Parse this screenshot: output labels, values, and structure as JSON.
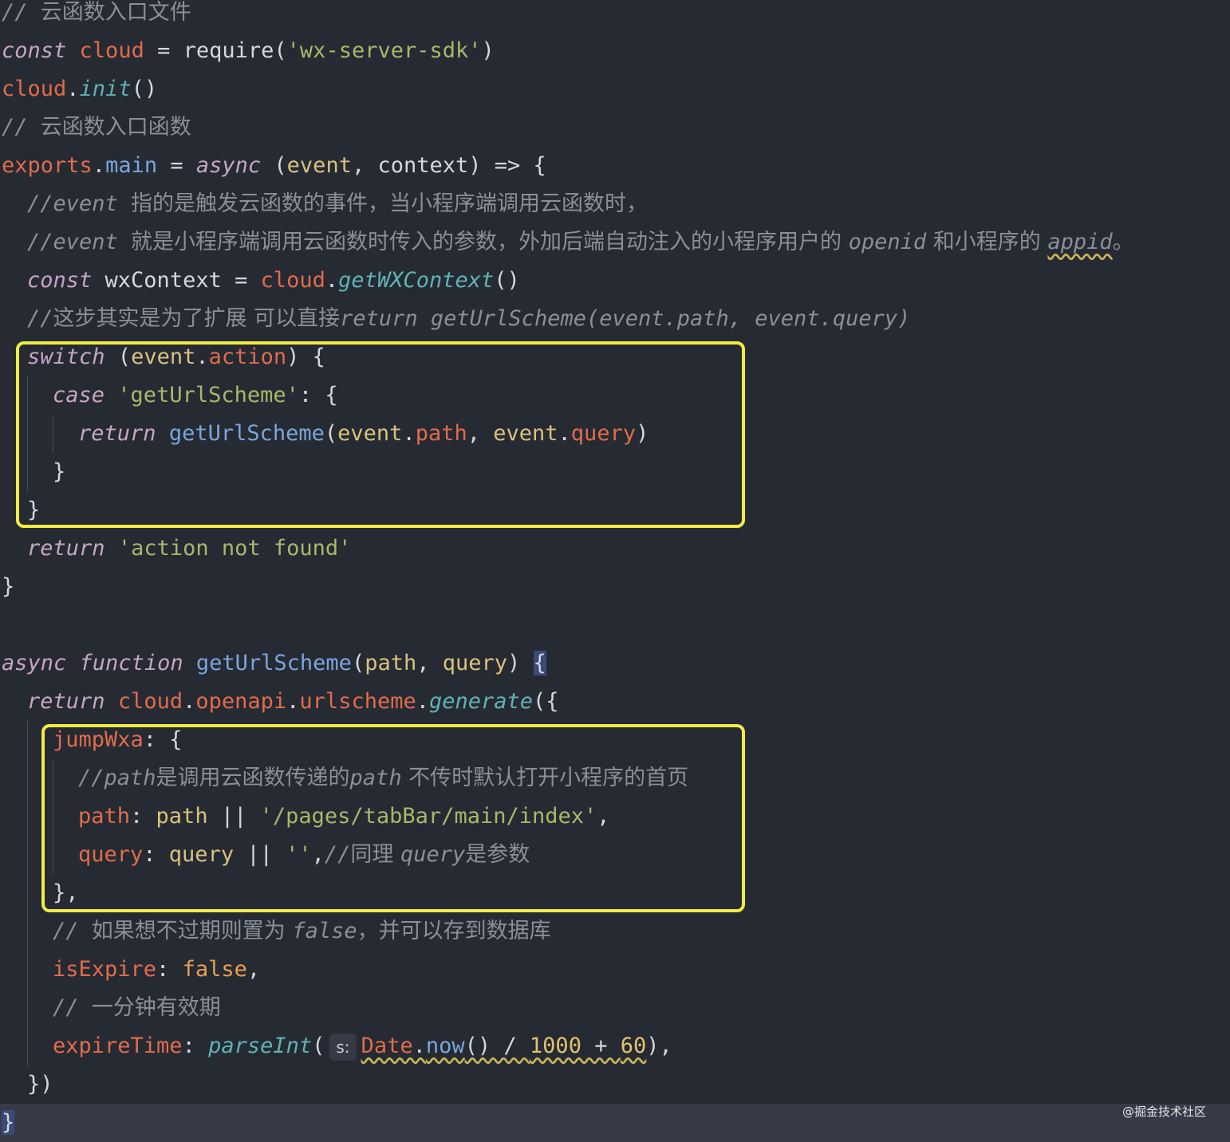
{
  "code_lines": [
    {
      "indent": 0,
      "tokens": [
        {
          "t": "// ",
          "c": "cmt"
        },
        {
          "t": "云函数入口文件",
          "c": "cmtcn"
        }
      ]
    },
    {
      "indent": 0,
      "tokens": [
        {
          "t": "const",
          "c": "kw"
        },
        {
          "t": " ",
          "c": "plain"
        },
        {
          "t": "cloud",
          "c": "ident"
        },
        {
          "t": " = ",
          "c": "plain"
        },
        {
          "t": "require",
          "c": "plain"
        },
        {
          "t": "(",
          "c": "plain"
        },
        {
          "t": "'wx-server-sdk'",
          "c": "str"
        },
        {
          "t": ")",
          "c": "plain"
        }
      ]
    },
    {
      "indent": 0,
      "tokens": [
        {
          "t": "cloud",
          "c": "ident"
        },
        {
          "t": ".",
          "c": "plain"
        },
        {
          "t": "init",
          "c": "fn"
        },
        {
          "t": "()",
          "c": "plain"
        }
      ]
    },
    {
      "indent": 0,
      "tokens": [
        {
          "t": "// ",
          "c": "cmt"
        },
        {
          "t": "云函数入口函数",
          "c": "cmtcn"
        }
      ]
    },
    {
      "indent": 0,
      "tokens": [
        {
          "t": "exports",
          "c": "ident"
        },
        {
          "t": ".",
          "c": "plain"
        },
        {
          "t": "main",
          "c": "fnname"
        },
        {
          "t": " = ",
          "c": "plain"
        },
        {
          "t": "async",
          "c": "kw"
        },
        {
          "t": " (",
          "c": "plain"
        },
        {
          "t": "event",
          "c": "param"
        },
        {
          "t": ", ",
          "c": "plain"
        },
        {
          "t": "context",
          "c": "plain"
        },
        {
          "t": ") => {",
          "c": "plain"
        }
      ]
    },
    {
      "indent": 1,
      "tokens": [
        {
          "t": "//event ",
          "c": "cmt"
        },
        {
          "t": "指的是触发云函数的事件，当小程序端调用云函数时，",
          "c": "cmtcn"
        }
      ]
    },
    {
      "indent": 1,
      "tokens": [
        {
          "t": "//event ",
          "c": "cmt"
        },
        {
          "t": "就是小程序端调用云函数时传入的参数，外加后端自动注入的小程序用户的 ",
          "c": "cmtcn"
        },
        {
          "t": "openid",
          "c": "cmt"
        },
        {
          "t": " 和小程序的 ",
          "c": "cmtcn"
        },
        {
          "t": "appid",
          "c": "cmt",
          "squiggle": true
        },
        {
          "t": "。",
          "c": "cmtcn"
        }
      ]
    },
    {
      "indent": 1,
      "tokens": [
        {
          "t": "const",
          "c": "kw"
        },
        {
          "t": " wxContext = ",
          "c": "plain"
        },
        {
          "t": "cloud",
          "c": "ident"
        },
        {
          "t": ".",
          "c": "plain"
        },
        {
          "t": "getWXContext",
          "c": "fn"
        },
        {
          "t": "()",
          "c": "plain"
        }
      ]
    },
    {
      "indent": 1,
      "tokens": [
        {
          "t": "//",
          "c": "cmt"
        },
        {
          "t": "这步其实是为了扩展 可以直接",
          "c": "cmtcn"
        },
        {
          "t": "return getUrlScheme(event.path, event.query)",
          "c": "cmt"
        }
      ]
    },
    {
      "indent": 1,
      "tokens": [
        {
          "t": "switch",
          "c": "kw"
        },
        {
          "t": " (",
          "c": "plain"
        },
        {
          "t": "event",
          "c": "param"
        },
        {
          "t": ".",
          "c": "plain"
        },
        {
          "t": "action",
          "c": "prop"
        },
        {
          "t": ") {",
          "c": "plain"
        }
      ]
    },
    {
      "indent": 2,
      "tokens": [
        {
          "t": "case",
          "c": "kw"
        },
        {
          "t": " ",
          "c": "plain"
        },
        {
          "t": "'getUrlScheme'",
          "c": "str"
        },
        {
          "t": ": {",
          "c": "plain"
        }
      ]
    },
    {
      "indent": 3,
      "tokens": [
        {
          "t": "return",
          "c": "kw"
        },
        {
          "t": " ",
          "c": "plain"
        },
        {
          "t": "getUrlScheme",
          "c": "fnname"
        },
        {
          "t": "(",
          "c": "plain"
        },
        {
          "t": "event",
          "c": "param"
        },
        {
          "t": ".",
          "c": "plain"
        },
        {
          "t": "path",
          "c": "prop"
        },
        {
          "t": ", ",
          "c": "plain"
        },
        {
          "t": "event",
          "c": "param"
        },
        {
          "t": ".",
          "c": "plain"
        },
        {
          "t": "query",
          "c": "prop"
        },
        {
          "t": ")",
          "c": "plain"
        }
      ]
    },
    {
      "indent": 2,
      "tokens": [
        {
          "t": "}",
          "c": "plain"
        }
      ]
    },
    {
      "indent": 1,
      "tokens": [
        {
          "t": "}",
          "c": "plain"
        }
      ]
    },
    {
      "indent": 1,
      "tokens": [
        {
          "t": "return",
          "c": "kw"
        },
        {
          "t": " ",
          "c": "plain"
        },
        {
          "t": "'action not found'",
          "c": "str"
        }
      ]
    },
    {
      "indent": 0,
      "tokens": [
        {
          "t": "}",
          "c": "plain"
        }
      ]
    },
    {
      "indent": 0,
      "tokens": []
    },
    {
      "indent": 0,
      "tokens": [
        {
          "t": "async",
          "c": "kw"
        },
        {
          "t": " ",
          "c": "plain"
        },
        {
          "t": "function",
          "c": "kw"
        },
        {
          "t": " ",
          "c": "plain"
        },
        {
          "t": "getUrlScheme",
          "c": "fnname"
        },
        {
          "t": "(",
          "c": "plain"
        },
        {
          "t": "path",
          "c": "param"
        },
        {
          "t": ", ",
          "c": "plain"
        },
        {
          "t": "query",
          "c": "param"
        },
        {
          "t": ") ",
          "c": "plain"
        },
        {
          "t": "{",
          "c": "plain",
          "bracket": true
        }
      ]
    },
    {
      "indent": 1,
      "tokens": [
        {
          "t": "return",
          "c": "kw"
        },
        {
          "t": " ",
          "c": "plain"
        },
        {
          "t": "cloud",
          "c": "ident"
        },
        {
          "t": ".",
          "c": "plain"
        },
        {
          "t": "openapi",
          "c": "ident"
        },
        {
          "t": ".",
          "c": "plain"
        },
        {
          "t": "urlscheme",
          "c": "ident"
        },
        {
          "t": ".",
          "c": "plain"
        },
        {
          "t": "generate",
          "c": "fn"
        },
        {
          "t": "({",
          "c": "plain"
        }
      ]
    },
    {
      "indent": 2,
      "tokens": [
        {
          "t": "jumpWxa",
          "c": "prop"
        },
        {
          "t": ": {",
          "c": "plain"
        }
      ]
    },
    {
      "indent": 3,
      "tokens": [
        {
          "t": "//path",
          "c": "cmt"
        },
        {
          "t": "是调用云函数传递的",
          "c": "cmtcn"
        },
        {
          "t": "path",
          "c": "cmt"
        },
        {
          "t": " 不传时默认打开小程序的首页",
          "c": "cmtcn"
        }
      ]
    },
    {
      "indent": 3,
      "tokens": [
        {
          "t": "path",
          "c": "prop"
        },
        {
          "t": ": ",
          "c": "plain"
        },
        {
          "t": "path",
          "c": "param"
        },
        {
          "t": " || ",
          "c": "plain"
        },
        {
          "t": "'/pages/tabBar/main/index'",
          "c": "str"
        },
        {
          "t": ",",
          "c": "plain"
        }
      ]
    },
    {
      "indent": 3,
      "tokens": [
        {
          "t": "query",
          "c": "prop"
        },
        {
          "t": ": ",
          "c": "plain"
        },
        {
          "t": "query",
          "c": "param"
        },
        {
          "t": " || ",
          "c": "plain"
        },
        {
          "t": "''",
          "c": "str"
        },
        {
          "t": ",",
          "c": "plain"
        },
        {
          "t": "//",
          "c": "cmt"
        },
        {
          "t": "同理 ",
          "c": "cmtcn"
        },
        {
          "t": "query",
          "c": "cmt"
        },
        {
          "t": "是参数",
          "c": "cmtcn"
        }
      ]
    },
    {
      "indent": 2,
      "tokens": [
        {
          "t": "},",
          "c": "plain"
        }
      ]
    },
    {
      "indent": 2,
      "tokens": [
        {
          "t": "// ",
          "c": "cmt"
        },
        {
          "t": "如果想不过期则置为 ",
          "c": "cmtcn"
        },
        {
          "t": "false",
          "c": "cmt"
        },
        {
          "t": "，并可以存到数据库",
          "c": "cmtcn"
        }
      ]
    },
    {
      "indent": 2,
      "tokens": [
        {
          "t": "isExpire",
          "c": "prop"
        },
        {
          "t": ": ",
          "c": "plain"
        },
        {
          "t": "false",
          "c": "var"
        },
        {
          "t": ",",
          "c": "plain"
        }
      ]
    },
    {
      "indent": 2,
      "tokens": [
        {
          "t": "// ",
          "c": "cmt"
        },
        {
          "t": "一分钟有效期",
          "c": "cmtcn"
        }
      ]
    },
    {
      "indent": 2,
      "tokens": [
        {
          "t": "expireTime",
          "c": "prop"
        },
        {
          "t": ": ",
          "c": "plain"
        },
        {
          "t": "parseInt",
          "c": "fn"
        },
        {
          "t": "(",
          "c": "plain"
        },
        {
          "t": "s:",
          "c": "hint"
        },
        {
          "t": "Date",
          "c": "ident",
          "squiggle": true
        },
        {
          "t": ".",
          "c": "plain",
          "squiggle": true
        },
        {
          "t": "now",
          "c": "fnname",
          "squiggle": true
        },
        {
          "t": "() / ",
          "c": "plain",
          "squiggle": true
        },
        {
          "t": "1000",
          "c": "num",
          "squiggle": true
        },
        {
          "t": " + ",
          "c": "plain",
          "squiggle": true
        },
        {
          "t": "60",
          "c": "num",
          "squiggle": true
        },
        {
          "t": "),",
          "c": "plain"
        }
      ]
    },
    {
      "indent": 1,
      "tokens": [
        {
          "t": "})",
          "c": "plain"
        }
      ]
    },
    {
      "indent": 0,
      "current": true,
      "tokens": [
        {
          "t": "}",
          "c": "plain",
          "bracket": true
        }
      ]
    }
  ],
  "highlight_boxes": [
    {
      "label": "switch-block"
    },
    {
      "label": "jumpWxa-block"
    }
  ],
  "watermark": "@掘金技术社区",
  "colors": {
    "background": "#262a33",
    "highlight_box": "#f2ec44"
  }
}
